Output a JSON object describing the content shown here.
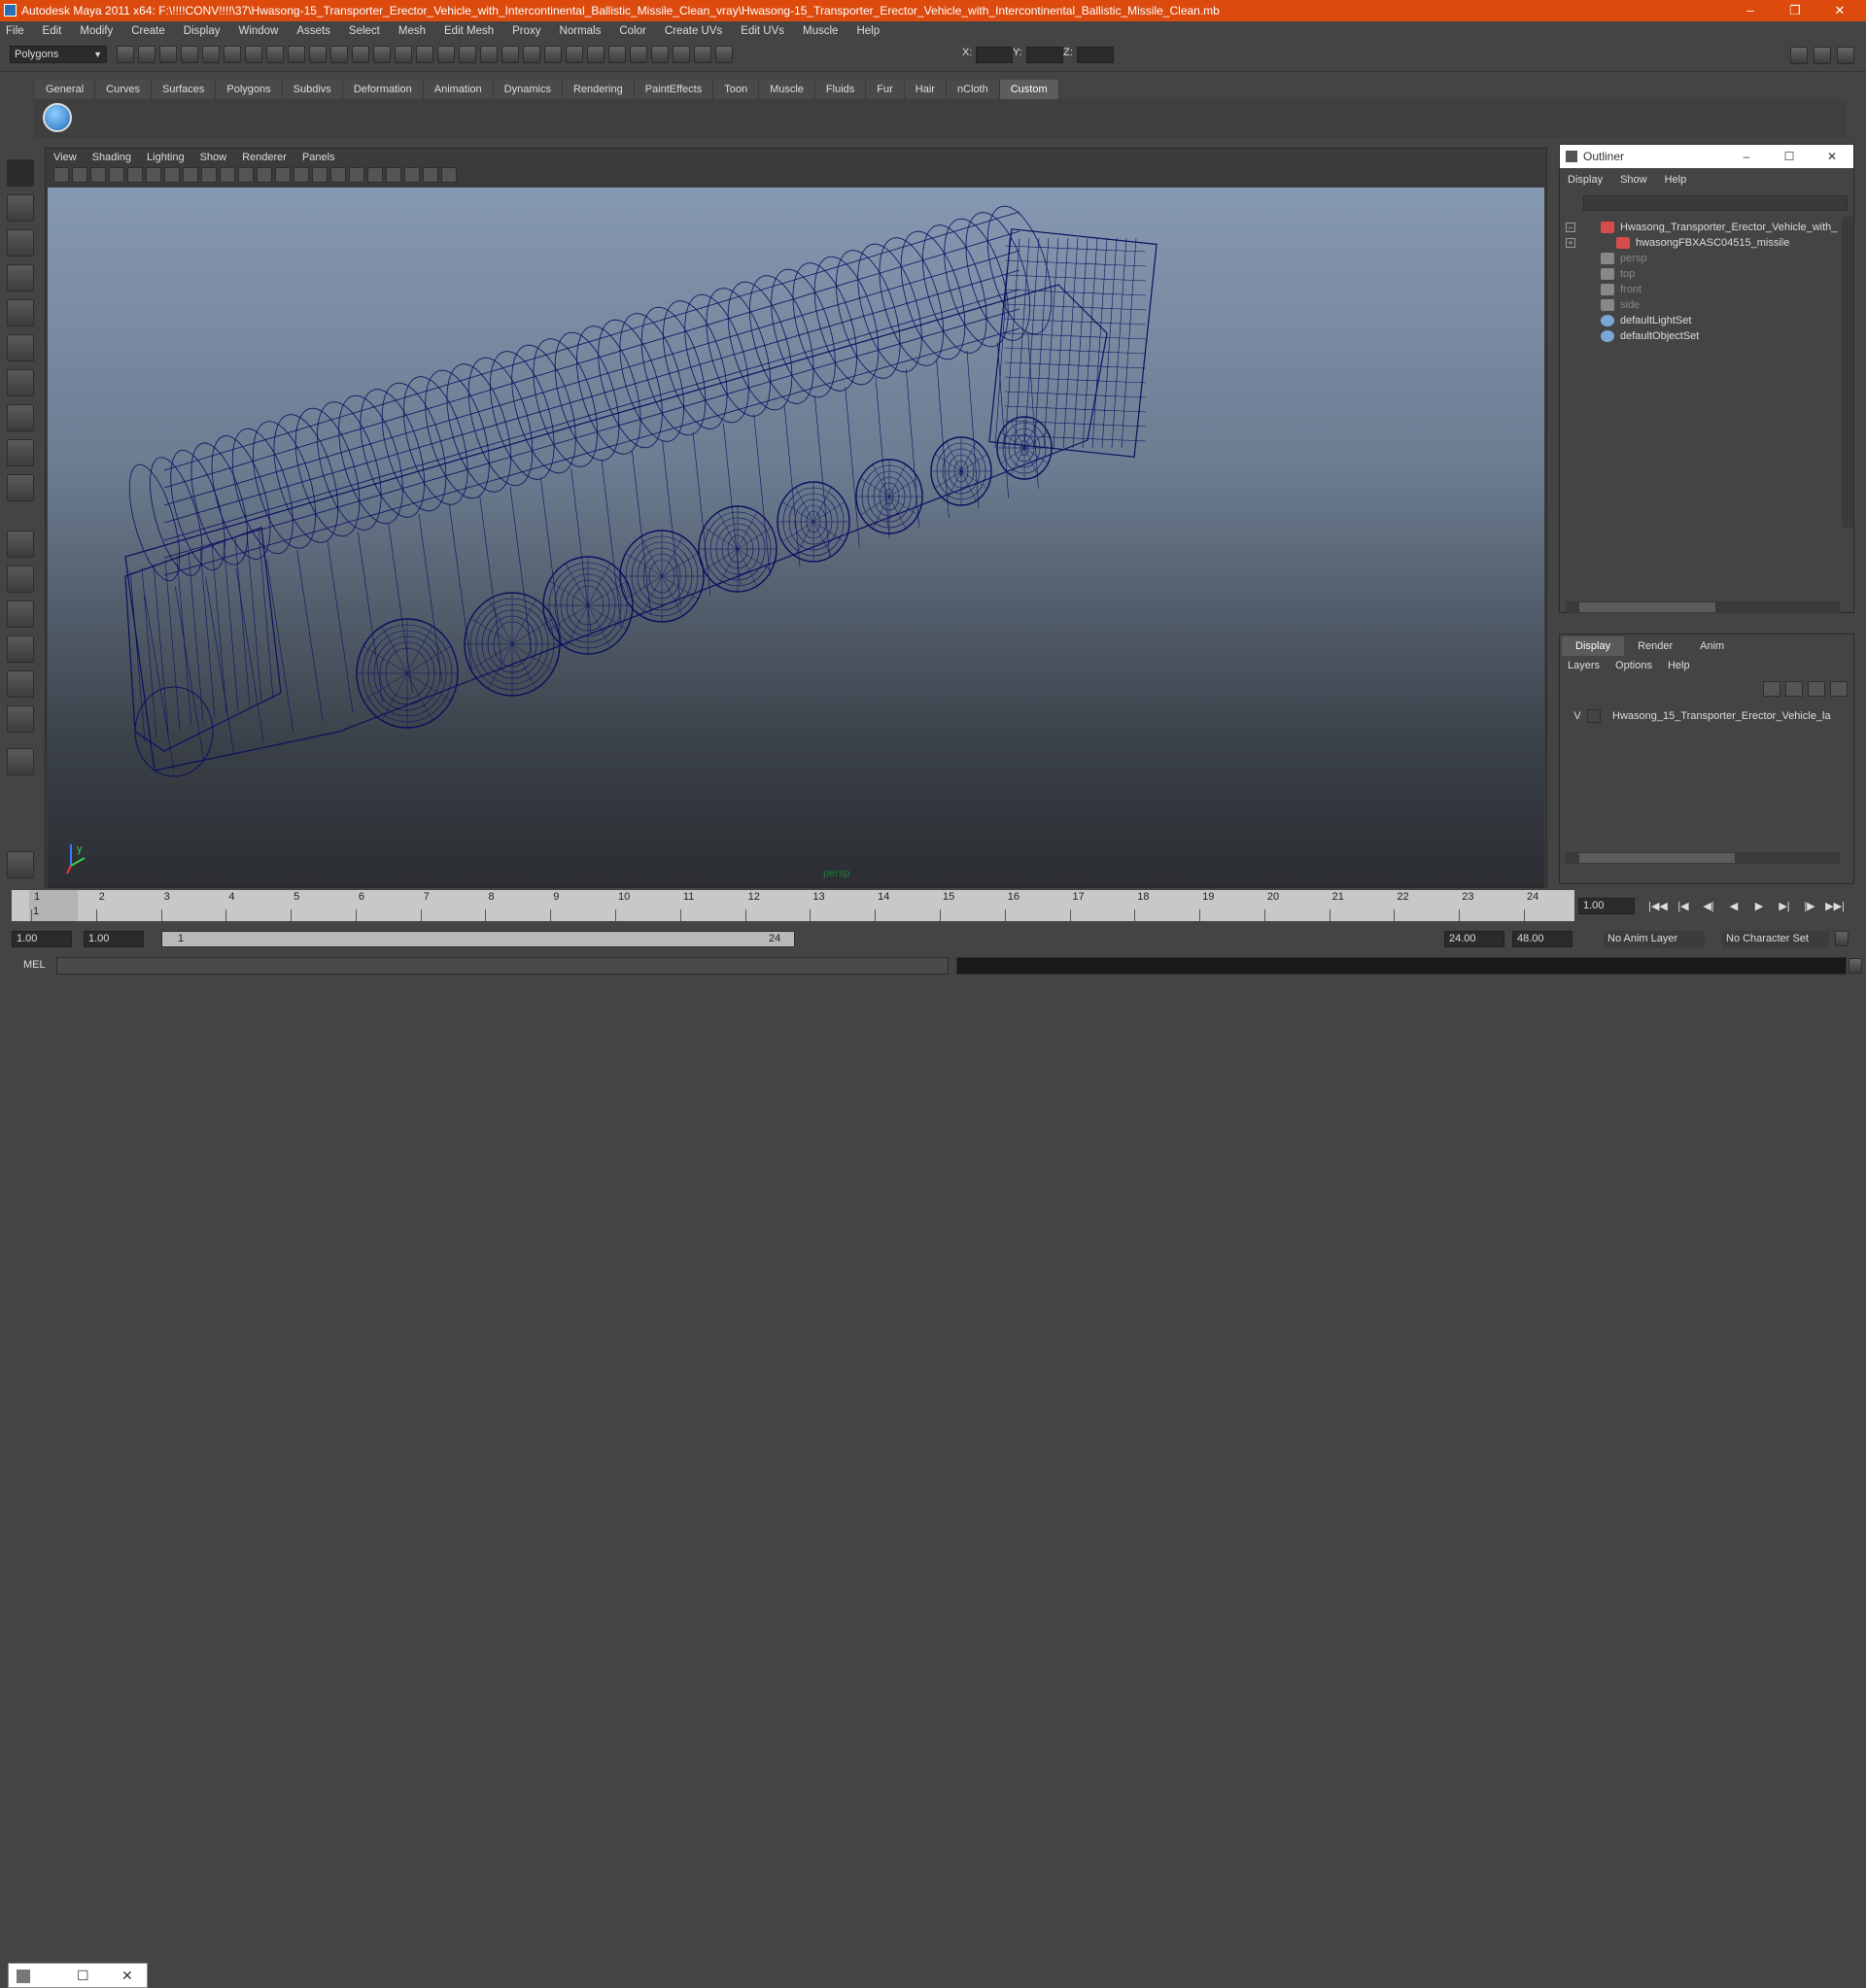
{
  "window": {
    "title": "Autodesk Maya 2011 x64: F:\\!!!!CONV!!!!\\37\\Hwasong-15_Transporter_Erector_Vehicle_with_Intercontinental_Ballistic_Missile_Clean_vray\\Hwasong-15_Transporter_Erector_Vehicle_with_Intercontinental_Ballistic_Missile_Clean.mb",
    "minimize": "–",
    "restore": "❐",
    "close": "✕"
  },
  "menubar": [
    "File",
    "Edit",
    "Modify",
    "Create",
    "Display",
    "Window",
    "Assets",
    "Select",
    "Mesh",
    "Edit Mesh",
    "Proxy",
    "Normals",
    "Color",
    "Create UVs",
    "Edit UVs",
    "Muscle",
    "Help"
  ],
  "toolbar": {
    "mode": "Polygons",
    "x_label": "X:",
    "y_label": "Y:",
    "z_label": "Z:"
  },
  "shelf_tabs": [
    "General",
    "Curves",
    "Surfaces",
    "Polygons",
    "Subdivs",
    "Deformation",
    "Animation",
    "Dynamics",
    "Rendering",
    "PaintEffects",
    "Toon",
    "Muscle",
    "Fluids",
    "Fur",
    "Hair",
    "nCloth",
    "Custom"
  ],
  "shelf_active": "Custom",
  "viewport": {
    "menu": [
      "View",
      "Shading",
      "Lighting",
      "Show",
      "Renderer",
      "Panels"
    ],
    "camera_label": "persp",
    "wire_color": "#0b0f5e"
  },
  "outliner": {
    "title": "Outliner",
    "menu": [
      "Display",
      "Show",
      "Help"
    ],
    "items": [
      {
        "label": "Hwasong_Transporter_Erector_Vehicle_with_",
        "indent": 0,
        "expander": "–",
        "dim": false,
        "icon": "mesh-icon"
      },
      {
        "label": "hwasongFBXASC04515_missile",
        "indent": 1,
        "expander": "+",
        "dim": false,
        "icon": "mesh-icon"
      },
      {
        "label": "persp",
        "indent": 0,
        "expander": "",
        "dim": true,
        "icon": "camera-icon"
      },
      {
        "label": "top",
        "indent": 0,
        "expander": "",
        "dim": true,
        "icon": "camera-icon"
      },
      {
        "label": "front",
        "indent": 0,
        "expander": "",
        "dim": true,
        "icon": "camera-icon"
      },
      {
        "label": "side",
        "indent": 0,
        "expander": "",
        "dim": true,
        "icon": "camera-icon"
      },
      {
        "label": "defaultLightSet",
        "indent": 0,
        "expander": "",
        "dim": false,
        "icon": "set-icon"
      },
      {
        "label": "defaultObjectSet",
        "indent": 0,
        "expander": "",
        "dim": false,
        "icon": "set-icon"
      }
    ]
  },
  "layers": {
    "tabs": [
      "Display",
      "Render",
      "Anim"
    ],
    "active_tab": "Display",
    "menu": [
      "Layers",
      "Options",
      "Help"
    ],
    "row": {
      "visible": "V",
      "name": "Hwasong_15_Transporter_Erector_Vehicle_la"
    }
  },
  "timeline": {
    "ticks": [
      1,
      2,
      3,
      4,
      5,
      6,
      7,
      8,
      9,
      10,
      11,
      12,
      13,
      14,
      15,
      16,
      17,
      18,
      19,
      20,
      21,
      22,
      23,
      24
    ],
    "current_frame_label": "1",
    "current_time": "1.00"
  },
  "range": {
    "start": "1.00",
    "start_inner": "1.00",
    "slider_start": "1",
    "slider_end": "24",
    "end_inner": "24.00",
    "end": "48.00",
    "anim_layer": "No Anim Layer",
    "character_set": "No Character Set"
  },
  "command": {
    "label": "MEL"
  }
}
